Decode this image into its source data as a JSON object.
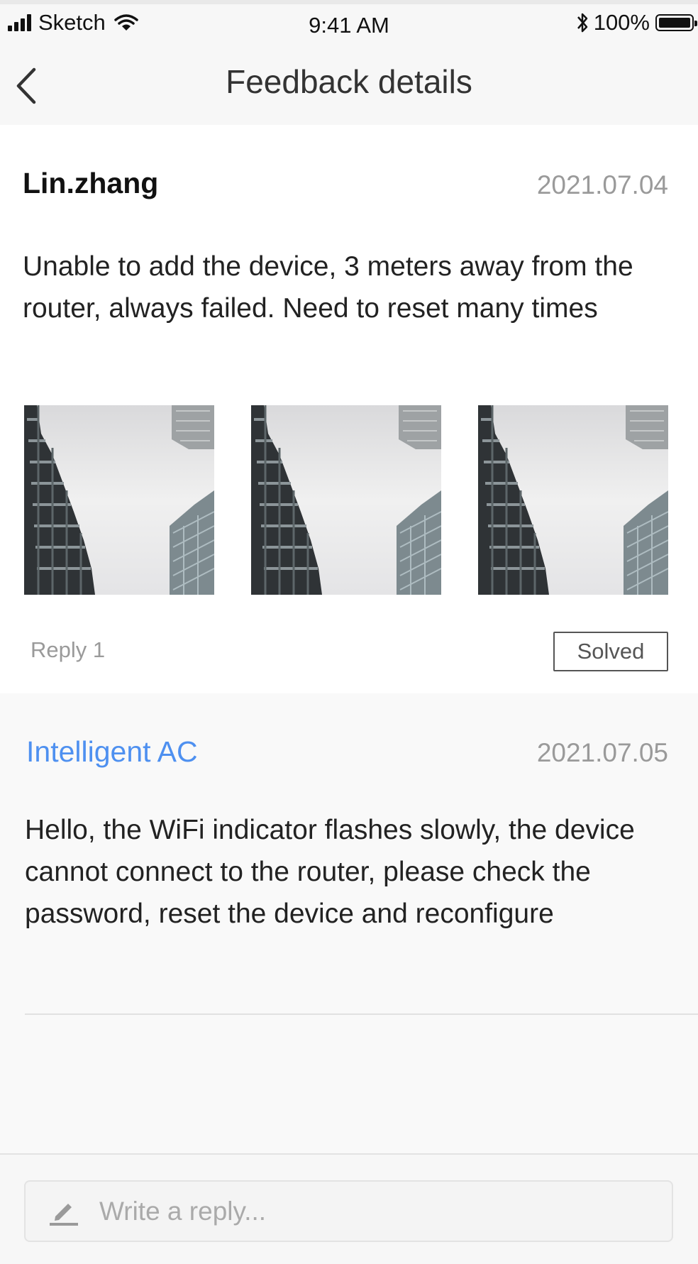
{
  "status_bar": {
    "carrier": "Sketch",
    "time": "9:41 AM",
    "battery": "100%",
    "icons": [
      "signal-icon",
      "wifi-icon",
      "bluetooth-icon",
      "battery-icon"
    ]
  },
  "nav": {
    "title": "Feedback details",
    "back_icon": "chevron-left-icon"
  },
  "feedback": {
    "author": "Lin.zhang",
    "date": "2021.07.04",
    "text": "Unable to add the device, 3 meters away from the router, always failed. Need to reset many times",
    "photos": [
      "building-photo",
      "building-photo",
      "building-photo"
    ],
    "reply_count_label": "Reply 1",
    "status_label": "Solved"
  },
  "reply": {
    "author": "Intelligent AC",
    "author_color": "#4e90f0",
    "date": "2021.07.05",
    "text": "Hello, the WiFi indicator flashes slowly, the device cannot connect to the router, please check the password, reset the device and reconfigure"
  },
  "composer": {
    "placeholder": "Write a reply...",
    "icon": "pencil-icon"
  }
}
